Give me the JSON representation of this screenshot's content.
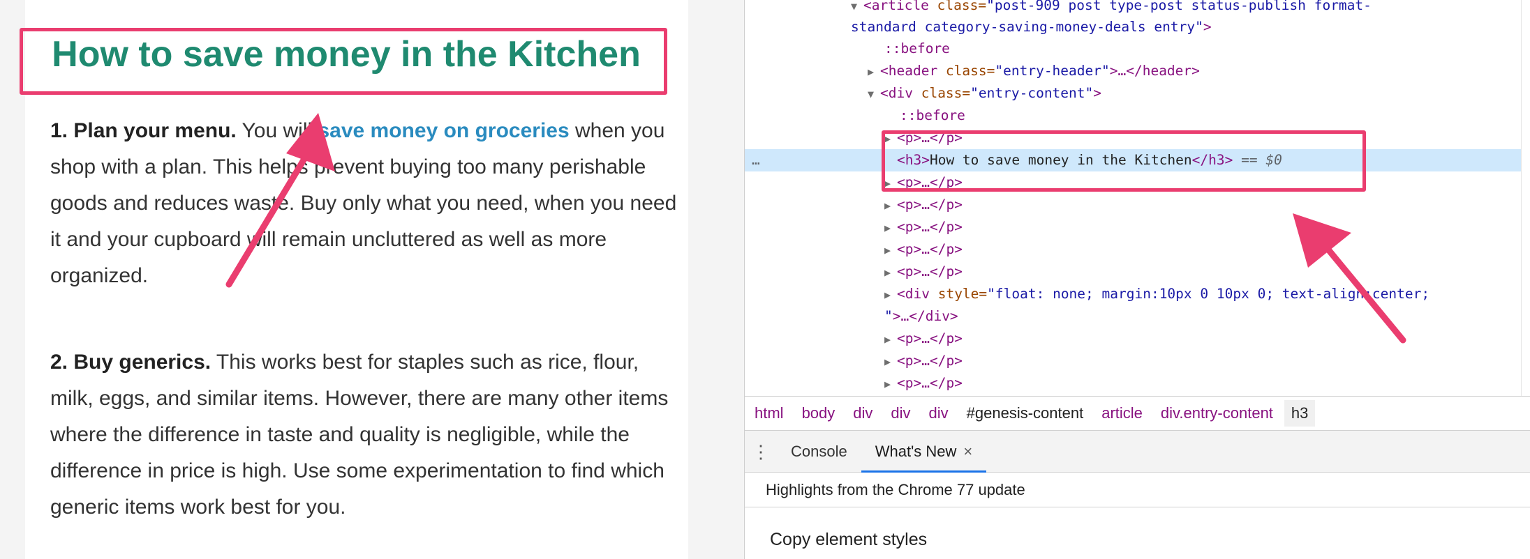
{
  "article": {
    "title": "How to save money in the Kitchen",
    "paragraphs": [
      {
        "bold": "1. Plan your menu.",
        "before_link": " You will ",
        "link": "save money on groceries",
        "after_link": " when you shop with a plan. This helps prevent buying too many perishable goods and reduces waste. Buy only what you need, when you need it and your cupboard will remain uncluttered as well as more organized."
      },
      {
        "bold": "2. Buy generics.",
        "text": " This works best for staples such as rice, flour, milk, eggs, and similar items. However, there are many other items where the difference in taste and quality is negligible, while the difference in price is high. Use some experimentation to find which generic items work best for you."
      }
    ]
  },
  "devtools": {
    "dom": {
      "article_line1_tag": "<article",
      "article_attr": " class=",
      "article_class_part1": "\"post-909 post type-post status-publish format-",
      "article_class_part2": "standard category-saving-money-deals entry\"",
      "close_bracket": ">",
      "before": "::before",
      "header_open": "<header",
      "header_attr": " class=",
      "header_val": "\"entry-header\"",
      "header_rest": ">…</header>",
      "div_open": "<div",
      "div_attr": " class=",
      "div_val": "\"entry-content\"",
      "div_close": ">",
      "p_collapsed": "<p>…</p>",
      "h3_open": "<h3>",
      "h3_text": "How to save money in the Kitchen",
      "h3_close": "</h3>",
      "selected_marker": "== $0",
      "ellipsis": "…",
      "styled_div_open": "<div",
      "styled_div_attr": " style=",
      "styled_div_val": "\"float: none; margin:10px 0 10px 0; text-align:center;",
      "styled_div_val_end": "\"",
      "styled_div_rest": ">…</div>"
    },
    "breadcrumb": [
      "html",
      "body",
      "div",
      "div",
      "div",
      "#genesis-content",
      "article",
      "div",
      "h3"
    ],
    "breadcrumb_class": ".entry-content",
    "drawer_tabs": [
      "Console",
      "What's New"
    ],
    "close_glyph": "×",
    "whats_new_banner": "Highlights from the Chrome 77 update",
    "copy_styles": "Copy element styles"
  },
  "colors": {
    "title_green": "#1f8a70",
    "link_blue": "#2a8bbf",
    "annotation_pink": "#ea3d6f",
    "selection_blue": "#cfe8fc",
    "tag_purple": "#881280",
    "attr_brown": "#994500",
    "value_blue": "#1a1aa6"
  },
  "icons": {
    "expand": "triangle-right-icon",
    "collapse": "triangle-down-icon",
    "drawer_menu": "kebab-menu-icon",
    "close": "close-icon"
  }
}
